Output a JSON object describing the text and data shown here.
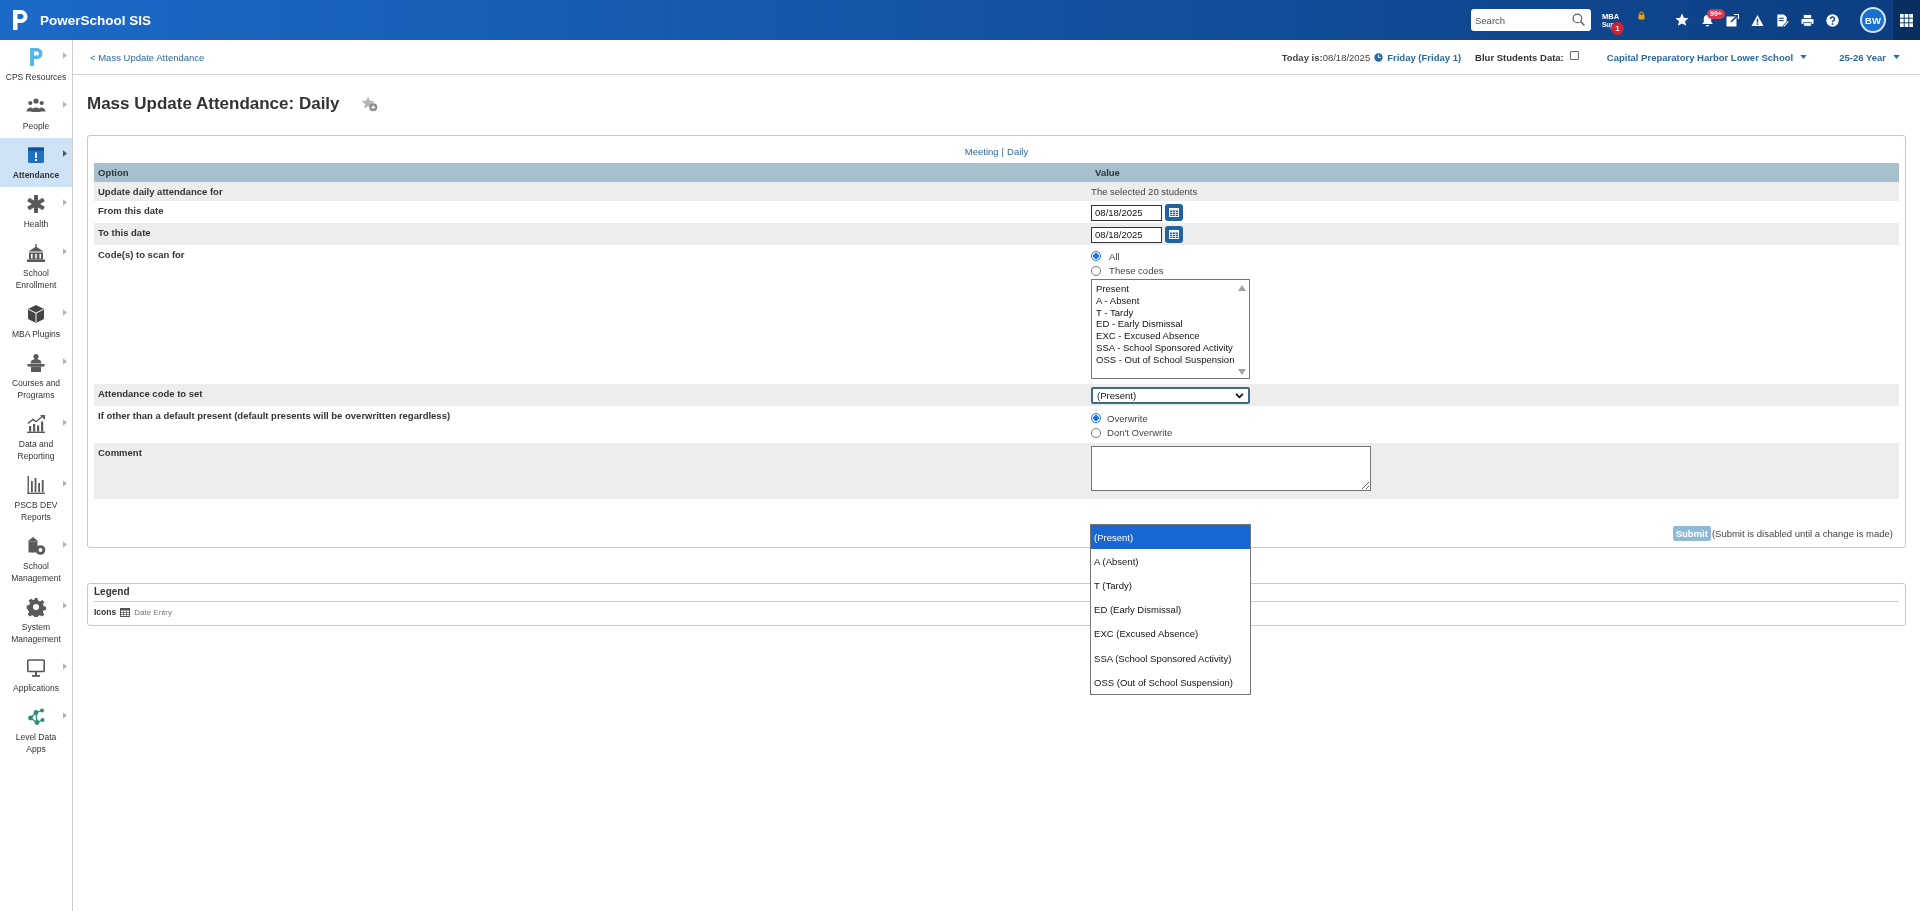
{
  "app_bar": {
    "title": "PowerSchool SIS",
    "search": {
      "placeholder": "Search"
    },
    "mba": {
      "label": "MBA",
      "sublabel": "Sup",
      "badge": "1"
    },
    "notifications": {
      "badge": "99+"
    },
    "avatar": {
      "initials": "BW"
    }
  },
  "sidebar": {
    "items": [
      {
        "label": "CPS Resources",
        "selected": false
      },
      {
        "label": "People",
        "selected": false
      },
      {
        "label": "Attendance",
        "selected": true
      },
      {
        "label": "Health",
        "selected": false
      },
      {
        "label": "School Enrollment",
        "selected": false
      },
      {
        "label": "MBA Plugins",
        "selected": false
      },
      {
        "label": "Courses and Programs",
        "selected": false
      },
      {
        "label": "Data and Reporting",
        "selected": false
      },
      {
        "label": "PSCB DEV Reports",
        "selected": false
      },
      {
        "label": "School Management",
        "selected": false
      },
      {
        "label": "System Management",
        "selected": false
      },
      {
        "label": "Applications",
        "selected": false
      },
      {
        "label": "Level Data Apps",
        "selected": false
      }
    ]
  },
  "header": {
    "breadcrumb": "< Mass Update Attendance",
    "today": "**Today is:**08/18/2025",
    "day": "Friday (Friday 1)",
    "blur": {
      "label": "Blur Students Data:",
      "checked": false
    },
    "school": "Capital Preparatory Harbor Lower School",
    "year": "25-26 Year"
  },
  "page": {
    "title": "Mass Update Attendance: Daily"
  },
  "form": {
    "mode_links": [
      "Meeting",
      "Daily"
    ],
    "separator": "|",
    "table": {
      "columns": [
        "Option",
        "Value"
      ],
      "rows": [
        {
          "kind": "text",
          "label": "Update daily attendance for",
          "value": "The selected 20 students"
        },
        {
          "kind": "date",
          "label": "From this date",
          "value": "08/18/2025"
        },
        {
          "kind": "date",
          "label": "To this date",
          "value": "08/18/2025"
        },
        {
          "kind": "codes",
          "label": "Code(s) to scan for",
          "options": [
            {
              "label": "All",
              "selected": true
            },
            {
              "label": "These codes",
              "selected": false
            }
          ],
          "codes": [
            "Present",
            "A - Absent",
            "T - Tardy",
            "ED - Early Dismissal",
            "EXC - Excused Absence",
            "SSA - School Sponsored Activity",
            "OSS - Out of School Suspension"
          ]
        },
        {
          "kind": "select",
          "label": "Attendance code to set",
          "value": "(Present)",
          "expanded": true,
          "options": [
            {
              "label": "(Present)",
              "selected": true
            },
            {
              "label": "A (Absent)",
              "selected": false
            },
            {
              "label": "T (Tardy)",
              "selected": false
            },
            {
              "label": "ED (Early Dismissal)",
              "selected": false
            },
            {
              "label": "EXC (Excused Absence)",
              "selected": false
            },
            {
              "label": "SSA (School Sponsored Activity)",
              "selected": false
            },
            {
              "label": "OSS (Out of School Suspension)",
              "selected": false
            }
          ]
        },
        {
          "kind": "radios",
          "label": "If other than a default present (default presents will be overwritten regardless)",
          "options": [
            {
              "label": "Overwrite",
              "selected": true
            },
            {
              "label": "Don't Overwrite",
              "selected": false
            }
          ]
        },
        {
          "kind": "textarea",
          "label": "Comment"
        }
      ]
    },
    "submit": {
      "label": "Submit",
      "disabled": true,
      "note": "(Submit is disabled until a change is made)"
    }
  },
  "legend": {
    "title": "Legend",
    "label": "Icons",
    "items": [
      {
        "label": "Date Entry"
      }
    ]
  }
}
